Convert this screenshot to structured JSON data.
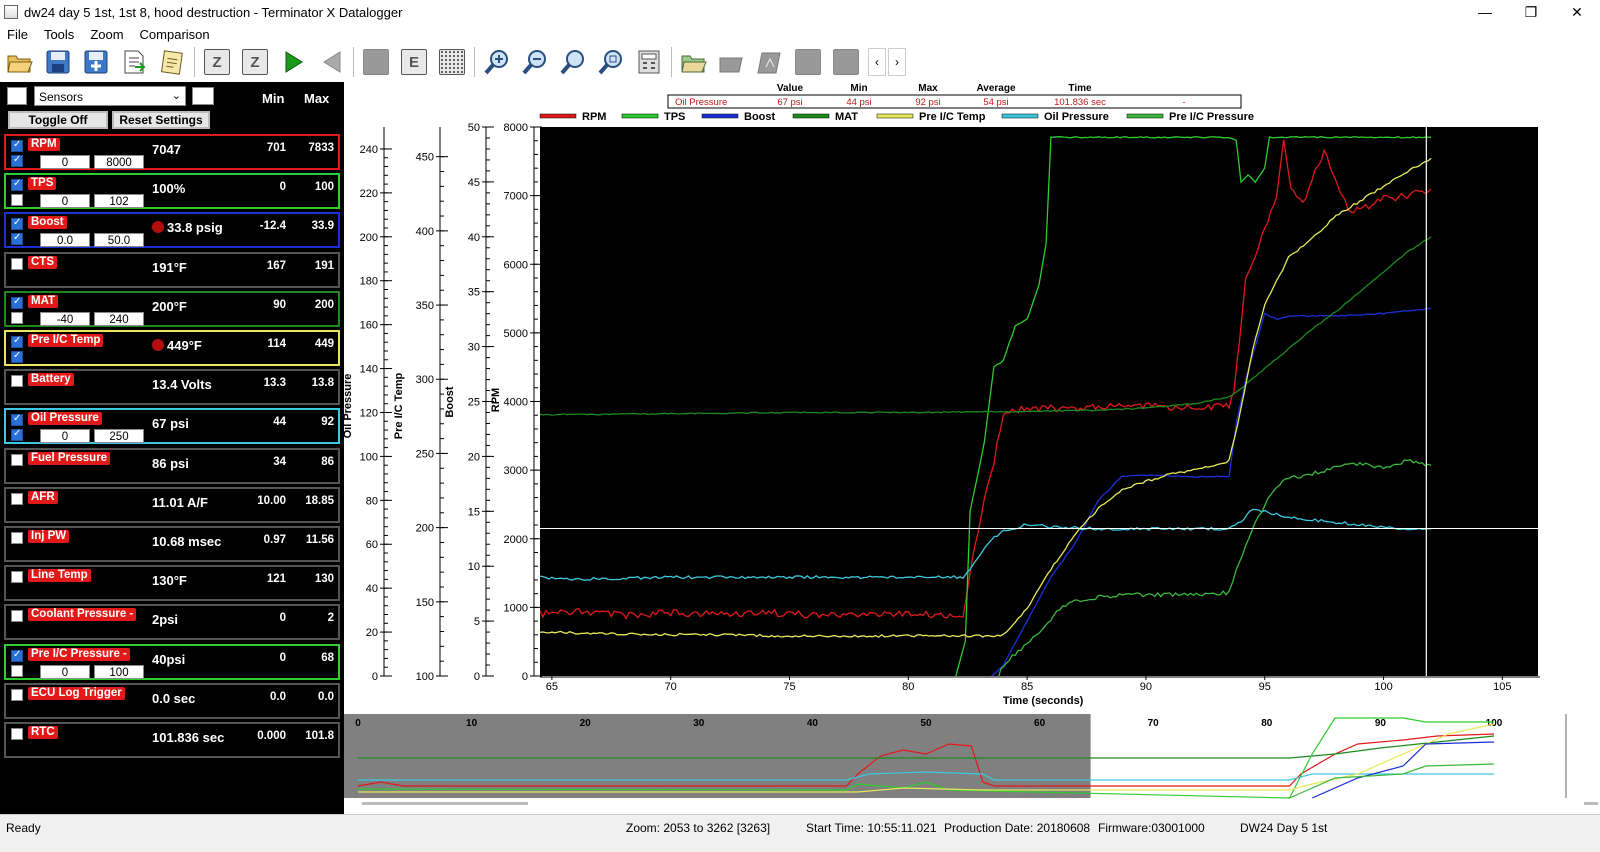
{
  "window": {
    "title": "dw24 day 5 1st, 1st 8, hood destruction - Terminator X Datalogger",
    "minimize": "—",
    "maximize": "❐",
    "close": "✕"
  },
  "menu": [
    "File",
    "Tools",
    "Zoom",
    "Comparison"
  ],
  "toolbar": {
    "icons": [
      "open-folder-icon",
      "save-icon",
      "save-as-icon",
      "export-icon",
      "notes-icon",
      "sort-za-icon",
      "z-icon",
      "play-icon",
      "back-icon",
      "blank-icon",
      "e-icon",
      "grid-dots-icon",
      "zoom-in-icon",
      "zoom-out-icon",
      "zoom-fit-icon",
      "zoom-reset-icon",
      "calculator-icon",
      "open-log-icon",
      "tag-icon",
      "compare-icon",
      "grey-box-icon",
      "grey-box-icon-2"
    ],
    "scroll_left": "‹",
    "scroll_right": "›"
  },
  "left_panel": {
    "dropdown_value": "Sensors",
    "toggle_off_label": "Toggle Off",
    "reset_settings_label": "Reset Settings",
    "min_header": "Min",
    "max_header": "Max",
    "sensors": [
      {
        "name": "RPM",
        "value": "7047",
        "min": "701",
        "max": "7833",
        "color": "#e11919",
        "checked": true,
        "scale_checked": true,
        "lo": "0",
        "hi": "8000",
        "alarm": false
      },
      {
        "name": "TPS",
        "value": "100%",
        "min": "0",
        "max": "100",
        "color": "#2ecc2e",
        "checked": true,
        "scale_checked": false,
        "lo": "0",
        "hi": "102",
        "alarm": false
      },
      {
        "name": "Boost",
        "value": "33.8 psig",
        "min": "-12.4",
        "max": "33.9",
        "color": "#1a2fd6",
        "checked": true,
        "scale_checked": true,
        "lo": "0.0",
        "hi": "50.0",
        "alarm": true
      },
      {
        "name": "CTS",
        "value": "191°F",
        "min": "167",
        "max": "191",
        "color": "#555555",
        "checked": false,
        "alarm": false
      },
      {
        "name": "MAT",
        "value": "200°F",
        "min": "90",
        "max": "200",
        "color": "#1c8a1c",
        "checked": true,
        "scale_checked": false,
        "lo": "-40",
        "hi": "240",
        "alarm": false
      },
      {
        "name": "Pre I/C Temp",
        "value": "449°F",
        "min": "114",
        "max": "449",
        "color": "#e8e85a",
        "checked": true,
        "scale_checked": true,
        "alarm": true
      },
      {
        "name": "Battery",
        "value": "13.4 Volts",
        "min": "13.3",
        "max": "13.8",
        "color": "#555555",
        "checked": false,
        "alarm": false
      },
      {
        "name": "Oil Pressure",
        "value": "67 psi",
        "min": "44",
        "max": "92",
        "color": "#3ec8e0",
        "checked": true,
        "scale_checked": true,
        "lo": "0",
        "hi": "250",
        "alarm": false
      },
      {
        "name": "Fuel Pressure",
        "value": "86 psi",
        "min": "34",
        "max": "86",
        "color": "#555555",
        "checked": false,
        "alarm": false
      },
      {
        "name": "AFR",
        "value": "11.01 A/F",
        "min": "10.00",
        "max": "18.85",
        "color": "#555555",
        "checked": false,
        "alarm": false
      },
      {
        "name": "Inj PW",
        "value": "10.68 msec",
        "min": "0.97",
        "max": "11.56",
        "color": "#555555",
        "checked": false,
        "alarm": false
      },
      {
        "name": "Line Temp",
        "value": "130°F",
        "min": "121",
        "max": "130",
        "color": "#555555",
        "checked": false,
        "alarm": false
      },
      {
        "name": "Coolant Pressure -",
        "value": "2psi",
        "min": "0",
        "max": "2",
        "color": "#555555",
        "checked": false,
        "alarm": false
      },
      {
        "name": "Pre I/C Pressure -",
        "value": "40psi",
        "min": "0",
        "max": "68",
        "color": "#2ecc2e",
        "checked": true,
        "scale_checked": false,
        "lo": "0",
        "hi": "100",
        "alarm": false
      },
      {
        "name": "ECU Log Trigger",
        "value": "0.0 sec",
        "min": "0.0",
        "max": "0.0",
        "color": "#555555",
        "checked": false,
        "alarm": false
      },
      {
        "name": "RTC",
        "value": "101.836 sec",
        "min": "0.000",
        "max": "101.8",
        "color": "#555555",
        "checked": false,
        "alarm": false
      }
    ]
  },
  "cursor_table": {
    "headers": [
      "Value",
      "Min",
      "Max",
      "Average",
      "Time"
    ],
    "row": {
      "name": "Oil Pressure",
      "value": "67 psi",
      "min": "44 psi",
      "max": "92 psi",
      "average": "54 psi",
      "time": "101.836 sec",
      "extra": "-"
    }
  },
  "chart_data": {
    "type": "line",
    "xlabel": "Time (seconds)",
    "xlim": [
      64.5,
      106.5
    ],
    "xticks": [
      65,
      70,
      75,
      80,
      85,
      90,
      95,
      100,
      105
    ],
    "cursor_x": 101.8,
    "hline_rpm": 2150,
    "axes": [
      {
        "label": "Oil Pressure",
        "min": 0,
        "max": 250,
        "ticks": [
          0,
          20,
          40,
          60,
          80,
          100,
          120,
          140,
          160,
          180,
          200,
          220,
          240
        ]
      },
      {
        "label": "Pre I/C Temp",
        "min": 100,
        "max": 470,
        "ticks": [
          100,
          150,
          200,
          250,
          300,
          350,
          400,
          450
        ]
      },
      {
        "label": "Boost",
        "min": 0,
        "max": 50,
        "ticks": [
          0,
          5,
          10,
          15,
          20,
          25,
          30,
          35,
          40,
          45,
          50
        ]
      },
      {
        "label": "RPM",
        "min": 0,
        "max": 8000,
        "ticks": [
          0,
          1000,
          2000,
          3000,
          4000,
          5000,
          6000,
          7000,
          8000
        ]
      }
    ],
    "legend": [
      "RPM",
      "TPS",
      "Boost",
      "MAT",
      "Pre I/C Temp",
      "Oil Pressure",
      "Pre I/C Pressure"
    ],
    "series": [
      {
        "name": "RPM",
        "color": "#e11919",
        "axis": 3,
        "x": [
          64.5,
          66,
          68,
          70,
          72,
          74,
          76,
          78,
          80,
          82,
          82.3,
          82.8,
          83.2,
          83.6,
          84,
          85,
          86,
          88,
          90,
          92,
          93.5,
          93.7,
          94.2,
          95,
          95.5,
          95.8,
          96.1,
          96.6,
          97.5,
          98.5,
          99,
          100,
          101,
          102
        ],
        "y": [
          900,
          950,
          880,
          920,
          900,
          930,
          890,
          910,
          900,
          880,
          870,
          1900,
          2600,
          3100,
          3850,
          3900,
          3900,
          3920,
          3950,
          3900,
          3950,
          4100,
          5800,
          6500,
          6950,
          7800,
          7100,
          6900,
          7650,
          6800,
          6800,
          6950,
          7000,
          7100
        ]
      },
      {
        "name": "TPS",
        "color": "#2ecc2e",
        "axis": 3,
        "x": [
          82,
          82.4,
          82.6,
          83.2,
          83.6,
          84,
          84.5,
          85,
          85.5,
          85.8,
          86,
          86.3,
          93.5,
          93.8,
          94,
          94.3,
          94.6,
          95,
          95.2,
          102
        ],
        "y": [
          0,
          500,
          2400,
          3400,
          4500,
          4600,
          5100,
          5200,
          5700,
          6300,
          7850,
          7850,
          7850,
          7800,
          7200,
          7300,
          7200,
          7400,
          7850,
          7850
        ]
      },
      {
        "name": "Boost",
        "color": "#1a2fd6",
        "axis": 2,
        "x": [
          83.5,
          84,
          85,
          86,
          87,
          88,
          89,
          90,
          91,
          92,
          93,
          93.5,
          93.8,
          94.2,
          94.6,
          95,
          95.5,
          96,
          98,
          100,
          102
        ],
        "y": [
          0,
          1,
          5,
          9,
          12,
          16,
          18.2,
          18.3,
          18.2,
          18.1,
          18.2,
          18.2,
          23,
          27,
          30,
          33,
          32.5,
          32.8,
          32.8,
          33.0,
          33.5
        ]
      },
      {
        "name": "MAT",
        "color": "#1c8a1c",
        "axis": 0,
        "x": [
          64.5,
          70,
          75,
          80,
          85,
          88,
          90,
          92,
          93.5,
          94,
          95,
          96,
          97,
          98,
          99,
          100,
          101,
          102
        ],
        "y": [
          119,
          119.5,
          120,
          120,
          120.5,
          121,
          122,
          124,
          127,
          131,
          140,
          149,
          158,
          166,
          175,
          184,
          193,
          200
        ]
      },
      {
        "name": "Pre I/C Temp",
        "color": "#e8e85a",
        "axis": 1,
        "x": [
          64.5,
          66,
          70,
          75,
          80,
          83.5,
          84,
          85,
          86,
          87,
          88,
          89,
          90,
          91,
          92,
          93,
          93.5,
          94,
          94.5,
          95,
          96,
          97,
          98,
          99,
          100,
          101,
          102
        ],
        "y": [
          130,
          129,
          128,
          127,
          127,
          127,
          128,
          145,
          172,
          195,
          213,
          226,
          231,
          236,
          239,
          242,
          245,
          280,
          320,
          350,
          382,
          395,
          410,
          420,
          430,
          440,
          449
        ]
      },
      {
        "name": "Oil Pressure",
        "color": "#3ec8e0",
        "axis": 0,
        "x": [
          64.5,
          66,
          70,
          75,
          80,
          82.3,
          82.6,
          83,
          83.5,
          84,
          85,
          86,
          88,
          90,
          92,
          93.5,
          94,
          94.5,
          95,
          96,
          97,
          98,
          99,
          100,
          101,
          102
        ],
        "y": [
          45,
          44,
          45,
          45,
          45,
          45,
          48,
          55,
          62,
          66,
          69,
          68,
          67,
          67,
          67,
          67,
          70,
          76,
          75,
          72,
          71,
          70,
          69,
          68,
          67,
          67
        ]
      },
      {
        "name": "Pre I/C Pressure",
        "color": "#3bb83b",
        "axis": 0,
        "x": [
          83.8,
          84,
          84.5,
          85,
          85.5,
          86,
          86.5,
          87,
          88,
          89,
          90,
          91,
          92,
          93.5,
          93.8,
          94.2,
          94.6,
          95,
          95.5,
          96,
          97,
          98,
          99,
          100,
          101,
          102
        ],
        "y": [
          0,
          5,
          10,
          15,
          20,
          26,
          32,
          34,
          36,
          37,
          37,
          37,
          37,
          38,
          48,
          60,
          70,
          78,
          86,
          90,
          92,
          95,
          97,
          95,
          98,
          96
        ]
      }
    ]
  },
  "overview": {
    "ticks": [
      "0",
      "10",
      "20",
      "30",
      "40",
      "50",
      "60",
      "70",
      "80",
      "90",
      "100"
    ]
  },
  "status": {
    "ready": "Ready",
    "zoom": "Zoom: 2053 to 3262 [3263]",
    "start_time": "Start Time: 10:55:11.021",
    "production_date": "Production Date: 20180608",
    "firmware": "Firmware:03001000",
    "log_name": "DW24 Day 5 1st"
  }
}
